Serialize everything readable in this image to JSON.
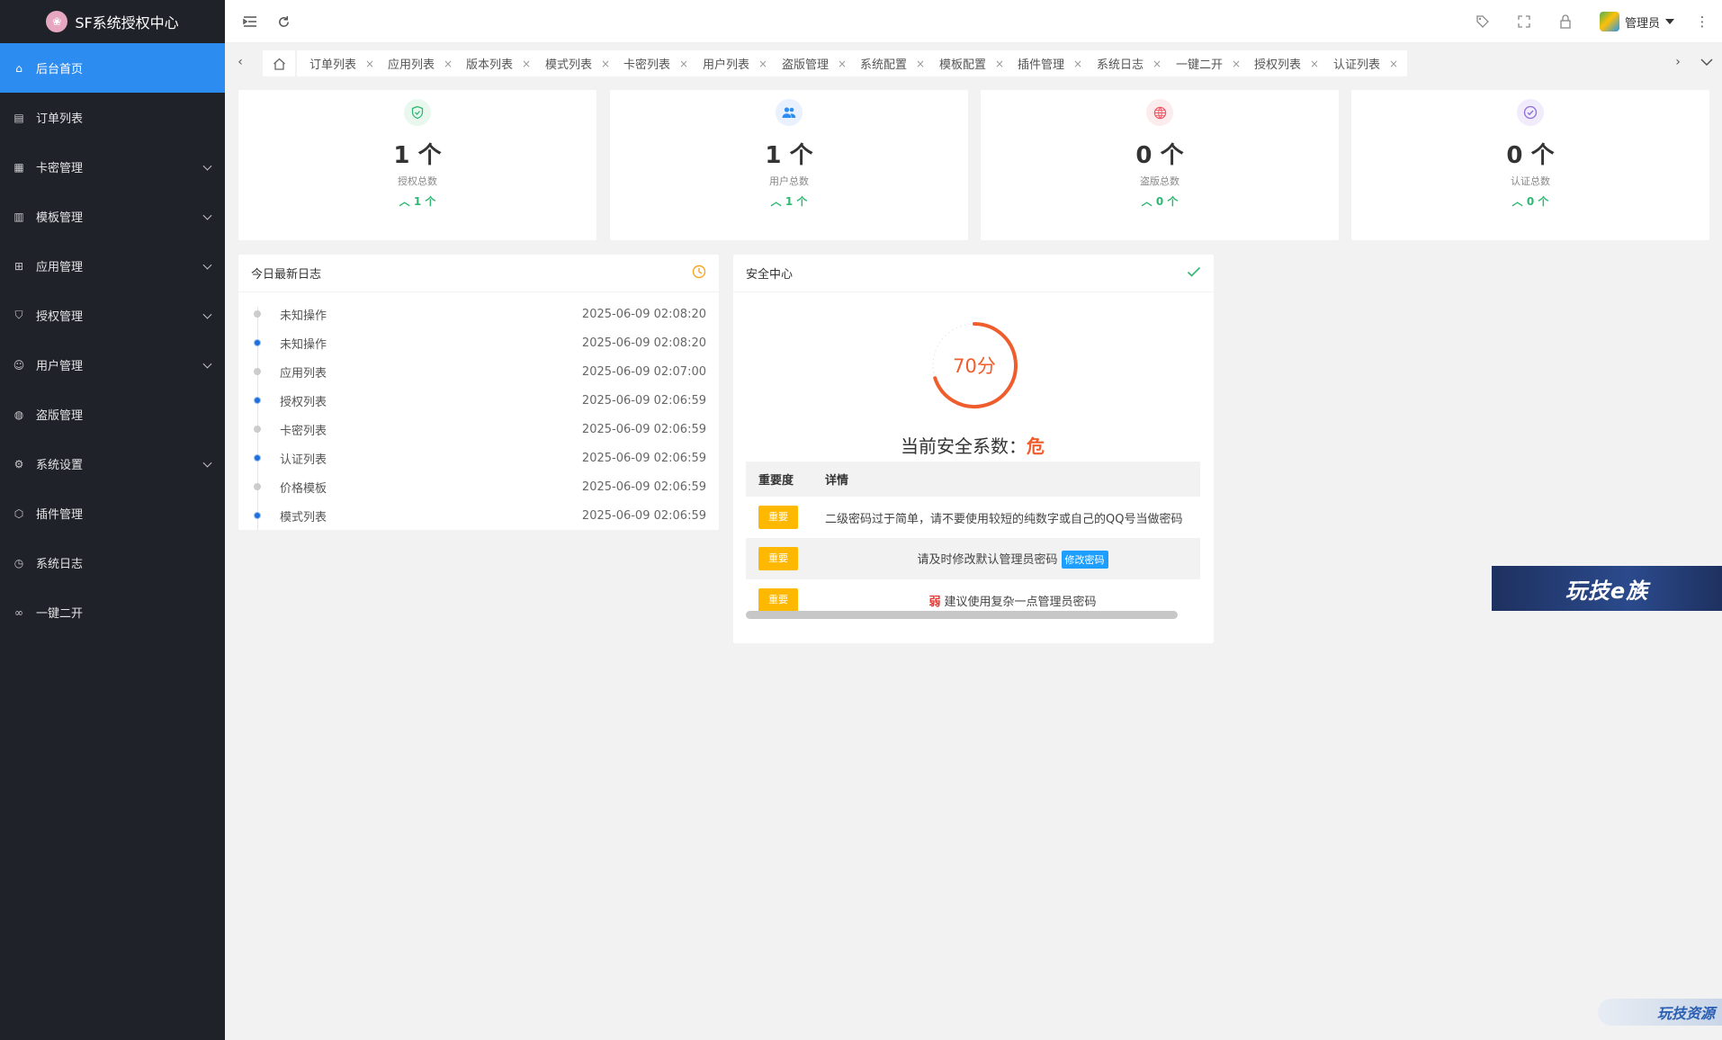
{
  "app": {
    "title": "SF系统授权中心",
    "logo_icon": "lotus-icon"
  },
  "sidebar": {
    "items": [
      {
        "label": "后台首页",
        "icon": "home-icon",
        "active": true,
        "has_children": false
      },
      {
        "label": "订单列表",
        "icon": "document-icon",
        "has_children": false
      },
      {
        "label": "卡密管理",
        "icon": "grid-icon",
        "has_children": true
      },
      {
        "label": "模板管理",
        "icon": "template-icon",
        "has_children": true
      },
      {
        "label": "应用管理",
        "icon": "apps-icon",
        "has_children": true
      },
      {
        "label": "授权管理",
        "icon": "shield-icon",
        "has_children": true
      },
      {
        "label": "用户管理",
        "icon": "user-icon",
        "has_children": true
      },
      {
        "label": "盗版管理",
        "icon": "globe-icon",
        "has_children": false
      },
      {
        "label": "系统设置",
        "icon": "gear-icon",
        "has_children": true
      },
      {
        "label": "插件管理",
        "icon": "cube-icon",
        "has_children": false
      },
      {
        "label": "系统日志",
        "icon": "clock-icon",
        "has_children": false
      },
      {
        "label": "一键二开",
        "icon": "infinity-icon",
        "has_children": false
      }
    ]
  },
  "topbar": {
    "user_label": "管理员",
    "icons": [
      "menu-fold-icon",
      "refresh-icon",
      "tag-icon",
      "fullscreen-icon",
      "lock-icon",
      "more-vertical-icon"
    ]
  },
  "tabs": {
    "items": [
      {
        "label": "订单列表"
      },
      {
        "label": "应用列表"
      },
      {
        "label": "版本列表"
      },
      {
        "label": "模式列表"
      },
      {
        "label": "卡密列表"
      },
      {
        "label": "用户列表"
      },
      {
        "label": "盗版管理"
      },
      {
        "label": "系统配置"
      },
      {
        "label": "模板配置"
      },
      {
        "label": "插件管理"
      },
      {
        "label": "系统日志"
      },
      {
        "label": "一键二开"
      },
      {
        "label": "授权列表"
      },
      {
        "label": "认证列表"
      }
    ],
    "close_glyph": "×"
  },
  "stats": [
    {
      "value": "1 个",
      "label": "授权总数",
      "change": "1 个",
      "icon": "shield-check-icon",
      "color": "#2eb872",
      "bg": "#e9f7ef"
    },
    {
      "value": "1 个",
      "label": "用户总数",
      "change": "1 个",
      "icon": "users-icon",
      "color": "#2d8cf0",
      "bg": "#e8f1fd"
    },
    {
      "value": "0 个",
      "label": "盗版总数",
      "change": "0 个",
      "icon": "globe-icon",
      "color": "#ed5565",
      "bg": "#fdecee"
    },
    {
      "value": "0 个",
      "label": "认证总数",
      "change": "0 个",
      "icon": "check-circle-icon",
      "color": "#8e6bd6",
      "bg": "#f1ecfb"
    }
  ],
  "logs": {
    "title": "今日最新日志",
    "icon": "clock-icon",
    "rows": [
      {
        "name": "未知操作",
        "time": "2025-06-09 02:08:20",
        "dot": "gray"
      },
      {
        "name": "未知操作",
        "time": "2025-06-09 02:08:20",
        "dot": "blue"
      },
      {
        "name": "应用列表",
        "time": "2025-06-09 02:07:00",
        "dot": "gray"
      },
      {
        "name": "授权列表",
        "time": "2025-06-09 02:06:59",
        "dot": "blue"
      },
      {
        "name": "卡密列表",
        "time": "2025-06-09 02:06:59",
        "dot": "gray"
      },
      {
        "name": "认证列表",
        "time": "2025-06-09 02:06:59",
        "dot": "blue"
      },
      {
        "name": "价格模板",
        "time": "2025-06-09 02:06:59",
        "dot": "gray"
      },
      {
        "name": "模式列表",
        "time": "2025-06-09 02:06:59",
        "dot": "blue"
      }
    ]
  },
  "security": {
    "title": "安全中心",
    "icon": "check-icon",
    "score": 70,
    "score_text": "70分",
    "status_label": "当前安全系数：",
    "status_value": "危",
    "color": "#f05d2c",
    "table": {
      "headers": [
        "重要度",
        "详情"
      ],
      "rows": [
        {
          "badge": "重要",
          "text": "二级密码过于简单，请不要使用较短的纯数字或自己的QQ号当做密码"
        },
        {
          "badge": "重要",
          "text": "请及时修改默认管理员密码",
          "button": "修改密码"
        },
        {
          "badge": "重要",
          "prefix": "弱",
          "text": "建议使用复杂一点管理员密码"
        }
      ]
    }
  },
  "ad": {
    "banner": "玩技e族",
    "watermark": "玩技资源"
  }
}
